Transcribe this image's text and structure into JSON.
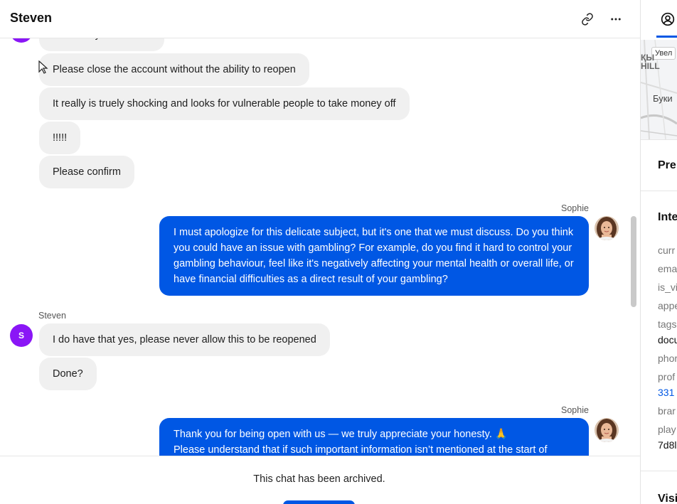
{
  "header": {
    "title": "Steven",
    "link_icon": "link-icon",
    "more_icon": "more-horizontal-icon"
  },
  "messages": {
    "incoming_top": [
      "Absolutely not thanks",
      "Please close the account without the ability to reopen",
      "It really is truely shocking and looks for vulnerable people to take money off",
      "!!!!!",
      "Please confirm"
    ],
    "agent_1": {
      "sender": "Sophie",
      "text": "I must apologize for this delicate subject, but it's one that we must discuss. Do you think you could have an issue with gambling? For example, do you find it hard to control your gambling behaviour, feel like it's negatively affecting your mental health or overall life, or have financial difficulties as a direct result of your gambling?"
    },
    "customer_block": {
      "sender": "Steven",
      "avatar_initial": "S",
      "items": [
        "I do have that yes, please never allow this to be reopened",
        "Done?"
      ]
    },
    "agent_2": {
      "sender": "Sophie",
      "line1": "Thank you for being open with us — we truly appreciate your honesty. 🙏",
      "line2": "Please understand that if such important information isn’t mentioned at the start of"
    }
  },
  "footer": {
    "archived_text": "This chat has been archived."
  },
  "sidebar": {
    "tab_icon": "user-circle-icon",
    "map": {
      "chip": "Увел",
      "label1": "ҚЫ",
      "label2": "HILL",
      "label3": "Буки"
    },
    "section_pre": "Pre",
    "section_inte": "Inte",
    "attributes": [
      "curr",
      "ema",
      "is_vi",
      "appe",
      "tags"
    ],
    "tags_value": "docu",
    "phone_label": "phor",
    "profile_label": "prof",
    "profile_value": "331",
    "brand_label": "brar",
    "player_label": "play",
    "player_value": "7d8l",
    "section_visi": "Visi"
  },
  "colors": {
    "agent_bubble": "#0057e4",
    "customer_bubble": "#f0f0f0",
    "customer_avatar": "#8a16f6"
  }
}
